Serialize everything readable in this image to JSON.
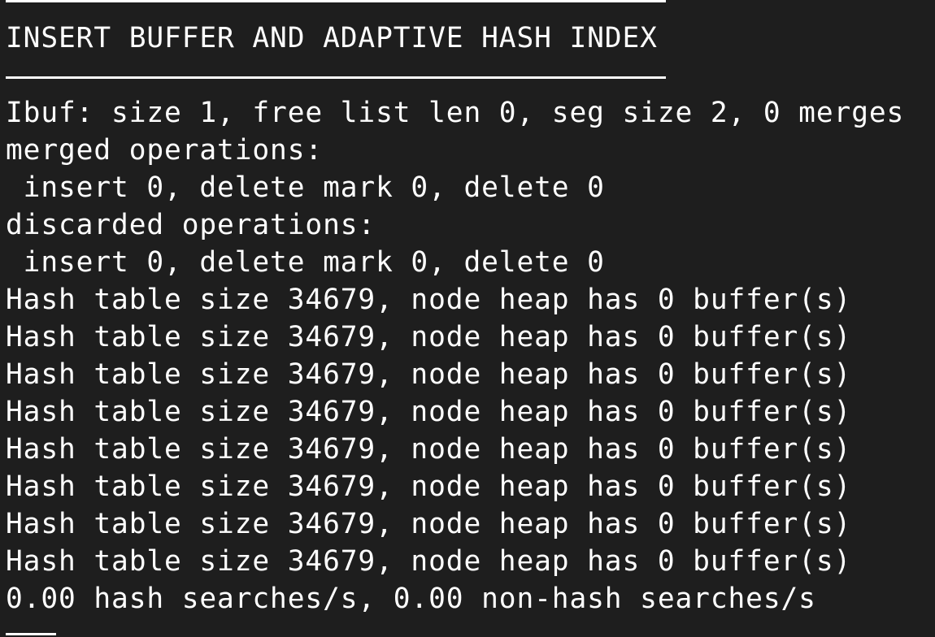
{
  "terminal": {
    "heading": "INSERT BUFFER AND ADAPTIVE HASH INDEX",
    "ibuf": "Ibuf: size 1, free list len 0, seg size 2, 0 merges",
    "merged_header": "merged operations:",
    "merged_values": " insert 0, delete mark 0, delete 0",
    "discarded_header": "discarded operations:",
    "discarded_values": " insert 0, delete mark 0, delete 0",
    "hash_tables": [
      "Hash table size 34679, node heap has 0 buffer(s)",
      "Hash table size 34679, node heap has 0 buffer(s)",
      "Hash table size 34679, node heap has 0 buffer(s)",
      "Hash table size 34679, node heap has 0 buffer(s)",
      "Hash table size 34679, node heap has 0 buffer(s)",
      "Hash table size 34679, node heap has 0 buffer(s)",
      "Hash table size 34679, node heap has 0 buffer(s)",
      "Hash table size 34679, node heap has 0 buffer(s)"
    ],
    "searches": "0.00 hash searches/s, 0.00 non-hash searches/s"
  },
  "colors": {
    "background": "#1e1e1e",
    "text": "#ffffff"
  }
}
